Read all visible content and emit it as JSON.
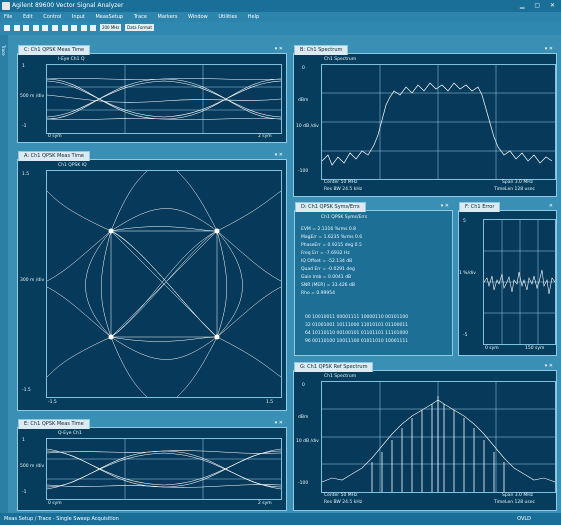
{
  "app": {
    "title": "Agilent 89600 Vector Signal Analyzer"
  },
  "menu": [
    "File",
    "Edit",
    "Control",
    "Input",
    "MeasSetup",
    "Trace",
    "Markers",
    "Window",
    "Utilities",
    "Help"
  ],
  "toolbar": {
    "field1": "200 MHz",
    "field2": "Data Format"
  },
  "sidetab_label": "Trace",
  "panels": {
    "eye_top": {
      "title": "C: Ch1 QPSK Meas Time",
      "y_top": "1",
      "y_mid": "500 m /div",
      "y_bot": "-1",
      "x_left": "0 sym",
      "x_right": "2 sym",
      "sub": "I-Eye   Ch1 Q"
    },
    "spectrum": {
      "title": "B: Ch1 Spectrum",
      "trace": "Ch1 Spectrum",
      "y_top": "0",
      "y_unit": "dBm",
      "y_div": "10 dB /div",
      "y_bot": "-100",
      "x_left": "Center 50 MHz",
      "x_left2": "Res BW 24.5 kHz",
      "x_right": "Span 3.0 MHz",
      "x_right2": "TimeLen 128 usec"
    },
    "iq": {
      "title": "A: Ch1 QPSK Meas Time",
      "trace": "Ch1 QPSK  IQ",
      "y_top": "1.5",
      "y_mid": "300 m /div",
      "y_bot": "-1.5",
      "x_left": "-1.5",
      "x_right": "1.5"
    },
    "symbols": {
      "title": "D: Ch1 QPSK Syms/Errs",
      "header": "Ch1 QPSK Syms/Errs",
      "rows": [
        [
          "EVM",
          "= 2.1316",
          "%rms",
          "0.8"
        ],
        [
          "MagErr",
          "= 1.6235",
          "%rms",
          "0.6"
        ],
        [
          "PhaseErr",
          "= 0.9215",
          "deg",
          "0.5"
        ],
        [
          "Freq Err",
          "= -7.6932",
          "Hz",
          ""
        ],
        [
          "IQ Offset",
          "= -52.134",
          "dB",
          ""
        ],
        [
          "Quad Err",
          "= -0.0291",
          "deg",
          ""
        ],
        [
          "Gain Imb",
          "= 0.0041",
          "dB",
          ""
        ],
        [
          "SNR (MER)",
          "= 33.426",
          "dB",
          ""
        ],
        [
          "Rho",
          "= 0.99954",
          "",
          ""
        ]
      ],
      "bits": [
        "00  10010011 00001111 10000110 00101100",
        "32  01001001 10111000 11010101 01100011",
        "64  10110110 00100101 01101101 11101000",
        "96  00110100 10011100 01011010 10001111"
      ]
    },
    "error": {
      "title": "F: Ch1 Error",
      "y_top": "5",
      "y_mid": "1 %/div",
      "y_bot": "-5",
      "x_left": "0 sym",
      "x_right": "150 sym"
    },
    "eye_bottom": {
      "title": "E: Ch1 QPSK Meas Time",
      "y_top": "1",
      "y_mid": "500 m /div",
      "y_bot": "-1",
      "x_left": "0 sym",
      "x_right": "2 sym",
      "sub": "Q-Eye   Ch1"
    },
    "acp": {
      "title": "G: Ch1 QPSK Ref Spectrum",
      "trace": "Ch1 Spectrum",
      "y_top": "0",
      "y_unit": "dBm",
      "y_div": "10 dB /div",
      "y_bot": "-100",
      "x_left": "Center 50 MHz",
      "x_left2": "Res BW 24.5 kHz",
      "x_right": "Span 3.0 MHz",
      "x_right2": "TimeLen 128 usec"
    }
  },
  "status": {
    "left": "Meas Setup / Trace - Single Sweep Acquisition",
    "right": "OVLD"
  },
  "colors": {
    "accent": "#3a8fb4",
    "plot_bg": "#07395a",
    "trace": "#ffffff"
  }
}
